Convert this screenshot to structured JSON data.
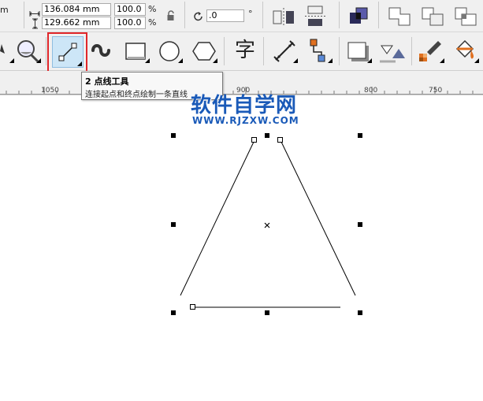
{
  "propbar": {
    "unit_fragment": "m",
    "width_value": "136.084 mm",
    "height_value": "129.662 mm",
    "scale_x": "100.0",
    "scale_y": "100.0",
    "percent_x": "%",
    "percent_y": "%",
    "rotation_value": ".0",
    "degree_symbol": "°"
  },
  "toolbar": {
    "text_tool_glyph": "字"
  },
  "ruler": {
    "ticks": [
      "1050",
      "900",
      "800",
      "750"
    ]
  },
  "tooltip": {
    "title": "2 点线工具",
    "description": "连接起点和终点绘制一条直线"
  },
  "watermark": {
    "main": "软件自学网",
    "sub": "WWW.RJZXW.COM"
  },
  "colors": {
    "highlight": "#e0262a",
    "watermark": "#1a5ab8",
    "toolbar_bg": "#f0f0f0"
  }
}
